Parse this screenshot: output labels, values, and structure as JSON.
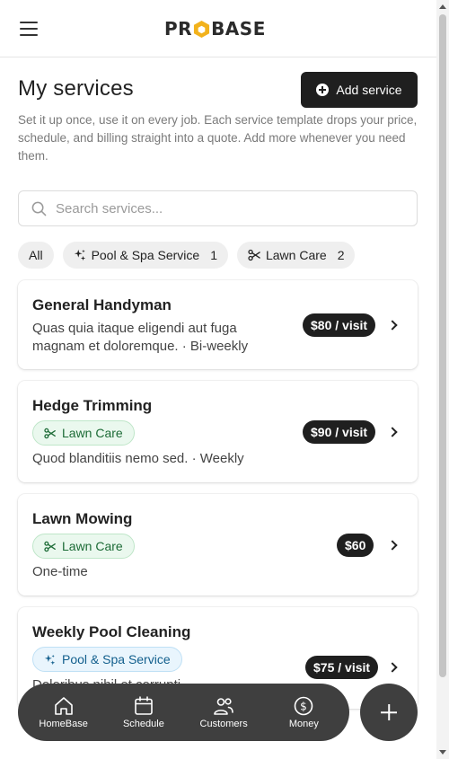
{
  "app": {
    "brand_left": "PR",
    "brand_right": "BASE"
  },
  "page": {
    "title": "My services",
    "subtitle": "Set it up once, use it on every job. Each service template drops your price, schedule, and billing straight into a quote. Add more whenever you need them.",
    "add_button": "Add service"
  },
  "search": {
    "placeholder": "Search services..."
  },
  "filters": [
    {
      "label": "All",
      "count": "",
      "icon": ""
    },
    {
      "label": "Pool & Spa Service",
      "count": "1",
      "icon": "sparkles-icon"
    },
    {
      "label": "Lawn Care",
      "count": "2",
      "icon": "scissors-icon"
    }
  ],
  "services": [
    {
      "name": "General Handyman",
      "description": "Quas quia itaque eligendi aut fuga magnam et doloremque. · Bi-weekly",
      "category": "",
      "price": "$80 / visit"
    },
    {
      "name": "Hedge Trimming",
      "description": "Quod blanditiis nemo sed. · Weekly",
      "category": "Lawn Care",
      "price": "$90 / visit"
    },
    {
      "name": "Lawn Mowing",
      "description": "One-time",
      "category": "Lawn Care",
      "price": "$60"
    },
    {
      "name": "Weekly Pool Cleaning",
      "description": "Doloribus nihil et corrupti.",
      "category": "Pool & Spa Service",
      "price": "$75 / visit"
    }
  ],
  "bottom_nav": [
    {
      "label": "HomeBase",
      "icon": "home-icon"
    },
    {
      "label": "Schedule",
      "icon": "calendar-icon"
    },
    {
      "label": "Customers",
      "icon": "users-icon"
    },
    {
      "label": "Money",
      "icon": "dollar-icon"
    }
  ],
  "colors": {
    "brand_accent": "#f2b21c",
    "primary_dark": "#1f1f1f",
    "nav_bg": "#3f3f3f",
    "lawn_green": "#1c6b36",
    "pool_blue": "#125f8d"
  }
}
